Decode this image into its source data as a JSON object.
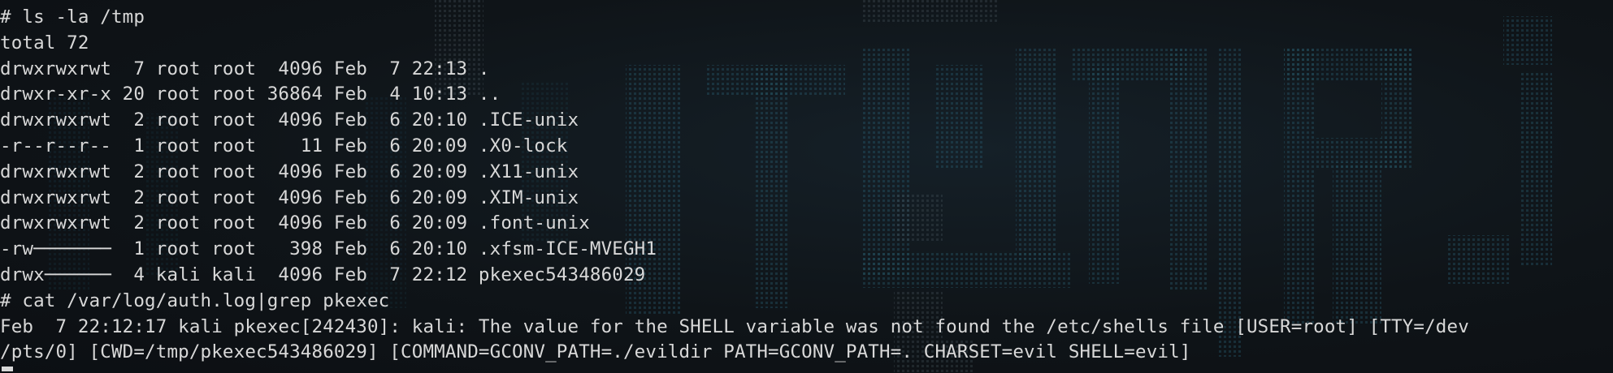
{
  "terminal": {
    "lines": [
      "# ls -la /tmp",
      "total 72",
      "drwxrwxrwt  7 root root  4096 Feb  7 22:13 .",
      "drwxr-xr-x 20 root root 36864 Feb  4 10:13 ..",
      "drwxrwxrwt  2 root root  4096 Feb  6 20:10 .ICE-unix",
      "-r--r--r--  1 root root    11 Feb  6 20:09 .X0-lock",
      "drwxrwxrwt  2 root root  4096 Feb  6 20:09 .X11-unix",
      "drwxrwxrwt  2 root root  4096 Feb  6 20:09 .XIM-unix",
      "drwxrwxrwt  2 root root  4096 Feb  6 20:09 .font-unix",
      "-rw───────  1 root root   398 Feb  6 20:10 .xfsm-ICE-MVEGH1",
      "drwx──────  4 kali kali  4096 Feb  7 22:12 pkexec543486029",
      "# cat /var/log/auth.log|grep pkexec",
      "Feb  7 22:12:17 kali pkexec[242430]: kali: The value for the SHELL variable was not found the /etc/shells file [USER=root] [TTY=/dev",
      "/pts/0] [CWD=/tmp/pkexec543486029] [COMMAND=GCONV_PATH=./evildir PATH=GCONV_PATH=. CHARSET=evil SHELL=evil]"
    ]
  },
  "colors": {
    "background": "#0f1217",
    "text": "#d8d8d8",
    "wallpaper_art": "#2f6f86"
  }
}
